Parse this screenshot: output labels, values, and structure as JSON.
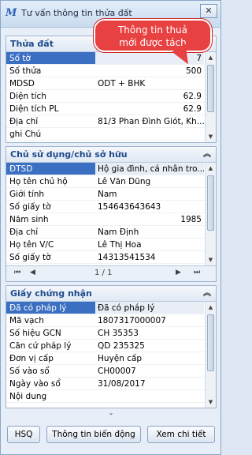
{
  "window": {
    "title": "Tư vấn thông tin thửa đất",
    "close_label": "✕"
  },
  "callout": {
    "text_line1": "Thông tin thuả",
    "text_line2": "mới được tách"
  },
  "thua_dat": {
    "header": "Thửa đất",
    "rows": [
      {
        "k": "Số tờ",
        "v": "7"
      },
      {
        "k": "Số thửa",
        "v": "500"
      },
      {
        "k": "MDSD",
        "v": "ODT + BHK"
      },
      {
        "k": "Diện tích",
        "v": "62.9"
      },
      {
        "k": "Diện tích PL",
        "v": "62.9"
      },
      {
        "k": "Địa chỉ",
        "v": "81/3 Phan Đình Giót, Kh..."
      },
      {
        "k": "ghi Chú",
        "v": ""
      }
    ]
  },
  "chu_su_dung": {
    "header": "Chủ sử dụng/chủ sở hữu",
    "rows": [
      {
        "k": "ĐTSD",
        "v": "Hộ gia đình, cá nhân tro..."
      },
      {
        "k": "Họ tên chủ hộ",
        "v": "Lê Văn Dũng"
      },
      {
        "k": "Giới tính",
        "v": "Nam"
      },
      {
        "k": "Số giấy tờ",
        "v": "154643643643"
      },
      {
        "k": "Năm sinh",
        "v": "1985"
      },
      {
        "k": "Địa chỉ",
        "v": "Nam Định"
      },
      {
        "k": "Họ tên V/C",
        "v": "Lê Thị Hoa"
      },
      {
        "k": "Số giấy tờ",
        "v": "14313541534"
      }
    ],
    "pager": {
      "first": "⏮",
      "prev": "◀",
      "page": "1 / 1",
      "next": "▶",
      "last": "⏭"
    }
  },
  "giay_chung_nhan": {
    "header": "Giấy chứng nhận",
    "rows": [
      {
        "k": "Đã có pháp lý",
        "v": "Đã có pháp lý"
      },
      {
        "k": "Mã vạch",
        "v": "1807317000007"
      },
      {
        "k": "Số hiệu GCN",
        "v": "CH 35353"
      },
      {
        "k": "Căn cứ pháp lý",
        "v": "QD 235325"
      },
      {
        "k": "Đơn vị cấp",
        "v": "Huyện cấp"
      },
      {
        "k": "Số vào sổ",
        "v": "CH00007"
      },
      {
        "k": "Ngày vào sổ",
        "v": "31/08/2017"
      },
      {
        "k": "Nội dung",
        "v": ""
      }
    ]
  },
  "buttons": {
    "hsq": "HSQ",
    "bien_dong": "Thông tin biến động",
    "chi_tiet": "Xem chi tiết"
  }
}
